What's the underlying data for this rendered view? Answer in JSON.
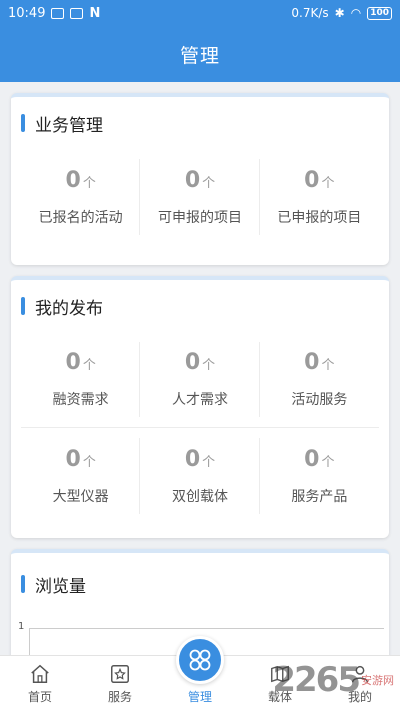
{
  "status": {
    "time": "10:49",
    "speed": "0.7K/s",
    "battery": "100"
  },
  "header": {
    "title": "管理"
  },
  "business": {
    "title": "业务管理",
    "items": [
      {
        "value": "0",
        "unit": "个",
        "label": "已报名的活动"
      },
      {
        "value": "0",
        "unit": "个",
        "label": "可申报的项目"
      },
      {
        "value": "0",
        "unit": "个",
        "label": "已申报的项目"
      }
    ]
  },
  "publish": {
    "title": "我的发布",
    "items": [
      {
        "value": "0",
        "unit": "个",
        "label": "融资需求"
      },
      {
        "value": "0",
        "unit": "个",
        "label": "人才需求"
      },
      {
        "value": "0",
        "unit": "个",
        "label": "活动服务"
      },
      {
        "value": "0",
        "unit": "个",
        "label": "大型仪器"
      },
      {
        "value": "0",
        "unit": "个",
        "label": "双创载体"
      },
      {
        "value": "0",
        "unit": "个",
        "label": "服务产品"
      }
    ]
  },
  "views": {
    "title": "浏览量",
    "y_tick": "1"
  },
  "nav": {
    "items": [
      {
        "label": "首页"
      },
      {
        "label": "服务"
      },
      {
        "label": "管理"
      },
      {
        "label": "载体"
      },
      {
        "label": "我的"
      }
    ]
  },
  "watermark": {
    "number": "2265",
    "text": "安游网"
  },
  "colors": {
    "primary": "#3a8ee0",
    "background": "#eef0f3"
  }
}
